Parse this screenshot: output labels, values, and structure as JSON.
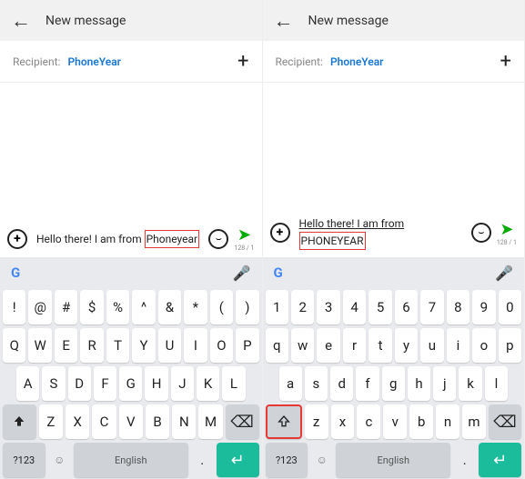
{
  "left": {
    "header": {
      "title": "New message"
    },
    "recipient": {
      "label": "Recipient:",
      "value": "PhoneYear"
    },
    "compose": {
      "prefix": "Hello there! I am from ",
      "highlight": "Phoneyear",
      "counter": "128 / 1"
    },
    "keyboard": {
      "row1": [
        "!",
        "@",
        "#",
        "$",
        "%",
        "^",
        "&",
        "*",
        "(",
        ")"
      ],
      "row2": [
        "Q",
        "W",
        "E",
        "R",
        "T",
        "Y",
        "U",
        "I",
        "O",
        "P"
      ],
      "row3": [
        "A",
        "S",
        "D",
        "F",
        "G",
        "H",
        "J",
        "K",
        "L"
      ],
      "row4": [
        "Z",
        "X",
        "C",
        "V",
        "B",
        "N",
        "M"
      ],
      "sym": "?123",
      "space": "English",
      "dot": "."
    }
  },
  "right": {
    "header": {
      "title": "New message"
    },
    "recipient": {
      "label": "Recipient:",
      "value": "PhoneYear"
    },
    "compose": {
      "line1": "Hello there! I am from",
      "highlight": "PHONEYEAR",
      "counter": "128 / 1"
    },
    "keyboard": {
      "row1": [
        "1",
        "2",
        "3",
        "4",
        "5",
        "6",
        "7",
        "8",
        "9",
        "0"
      ],
      "row2": [
        "q",
        "w",
        "e",
        "r",
        "t",
        "y",
        "u",
        "i",
        "o",
        "p"
      ],
      "row3": [
        "a",
        "s",
        "d",
        "f",
        "g",
        "h",
        "j",
        "k",
        "l"
      ],
      "row4": [
        "z",
        "x",
        "c",
        "v",
        "b",
        "n",
        "m"
      ],
      "sym": "?123",
      "space": "English",
      "dot": "."
    }
  }
}
